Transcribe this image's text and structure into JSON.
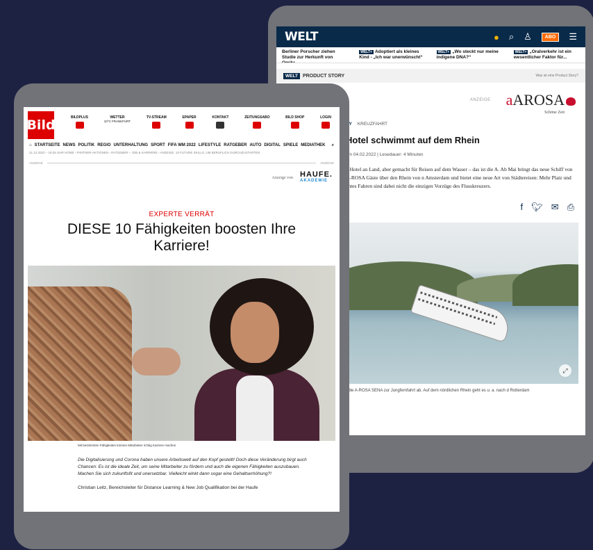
{
  "welt": {
    "logo": "WELT",
    "abo": "ABO",
    "ticker": [
      {
        "badge": "",
        "text": "Berliner Porscher ziehen Studie zur Herkunft von Omikr..."
      },
      {
        "badge": "WELT+",
        "text": "Adoptiert als kleines Kind - „Ich war unerwünscht“"
      },
      {
        "badge": "WELT+",
        "text": "„Wo steckt nur meine indigene DNA?“"
      },
      {
        "badge": "WELT+",
        "text": "„Oralverkehr ist ein wesentlicher Faktor für..."
      }
    ],
    "product_story_tag": "WELT",
    "product_story_label": "PRODUCT STORY",
    "product_story_link": "Was ist eine Product Story?",
    "anzeige": "ANZEIGE",
    "brand": "AROSA",
    "brand_sub": "Schöne Zeit",
    "category_1": "RY",
    "category_2": "KREUZFAHRT",
    "headline": "Hotel schwimmt auf dem Rhein",
    "meta": "am 04.02.2022 | Lesedauer: 4 Minuten",
    "body": "n Hotel an Land, aber gemacht für Reisen auf dem Wasser – das ist die A. Ab Mai bringt das neue Schiff von A-ROSA Gäste über den Rhein von n Amsterdam und bietet eine neue Art von Städtereisen: Mehr Platz und entes Fahren sind dabei nicht die einzigen Vorzüge des Flusskreuzers.",
    "caption": "t die A-ROSA SENA zur Jungfernfahrt ab. Auf dem nördlichen Rhein geht es u. a. nach d Rotterdam"
  },
  "bild": {
    "logo": "Bild",
    "nav": [
      {
        "label": "BILDPLUS",
        "sub": ""
      },
      {
        "label": "WETTER",
        "sub": "10°C FRANKFURT"
      },
      {
        "label": "TV-STREAM",
        "sub": ""
      },
      {
        "label": "EPAPER",
        "sub": ""
      },
      {
        "label": "KONTAKT",
        "sub": ""
      },
      {
        "label": "ZEITUNGSABO",
        "sub": ""
      },
      {
        "label": "BILD SHOP",
        "sub": ""
      },
      {
        "label": "LOGIN",
        "sub": ""
      }
    ],
    "menu": [
      "STARTSEITE",
      "NEWS",
      "POLITIK",
      "REGIO",
      "UNTERHALTUNG",
      "SPORT",
      "FIFA WM 2022",
      "LIFESTYLE",
      "RATGEBER",
      "AUTO",
      "DIGITAL",
      "SPIELE",
      "MEDIATHEK"
    ],
    "breadcrumb": "21.12.2022 – 19:25 UHR   HOME › PARTNER-AKTIONEN › RATGEBER – JOB & KARRIERE › ANZEIGE: 10 FUTURE SKILLS, UM BERUFLICH DURCHZUSTARTEN",
    "anzeige": "ANZEIGE",
    "anzeige_von": "Anzeige von",
    "haufe": "HAUFE.",
    "haufe_sub": "AKADEMIE",
    "kicker": "EXPERTE VERRÄT",
    "headline": "DIESE 10 Fähigkeiten boosten Ihre Karriere!",
    "caption": "Mit bestimmten Fähigkeiten können Mitarbeiter richtig Karriere machen",
    "lead": "Die Digitalisierung und Corona haben unsere Arbeitswelt auf den Kopf gestellt! Doch diese Veränderung birgt auch Chancen: Es ist die ideale Zeit, um seine Mitarbeiter zu fördern und auch die eigenen Fähigkeiten auszubauen. Machen Sie sich zukunftsfit und unersetzbar. Vielleicht winkt dann sogar eine Gehaltserhöhung?!",
    "para": "Christian Leitz, Bereichsleiter für Distance Learning & New Job Qualifikation bei der Haufe"
  }
}
